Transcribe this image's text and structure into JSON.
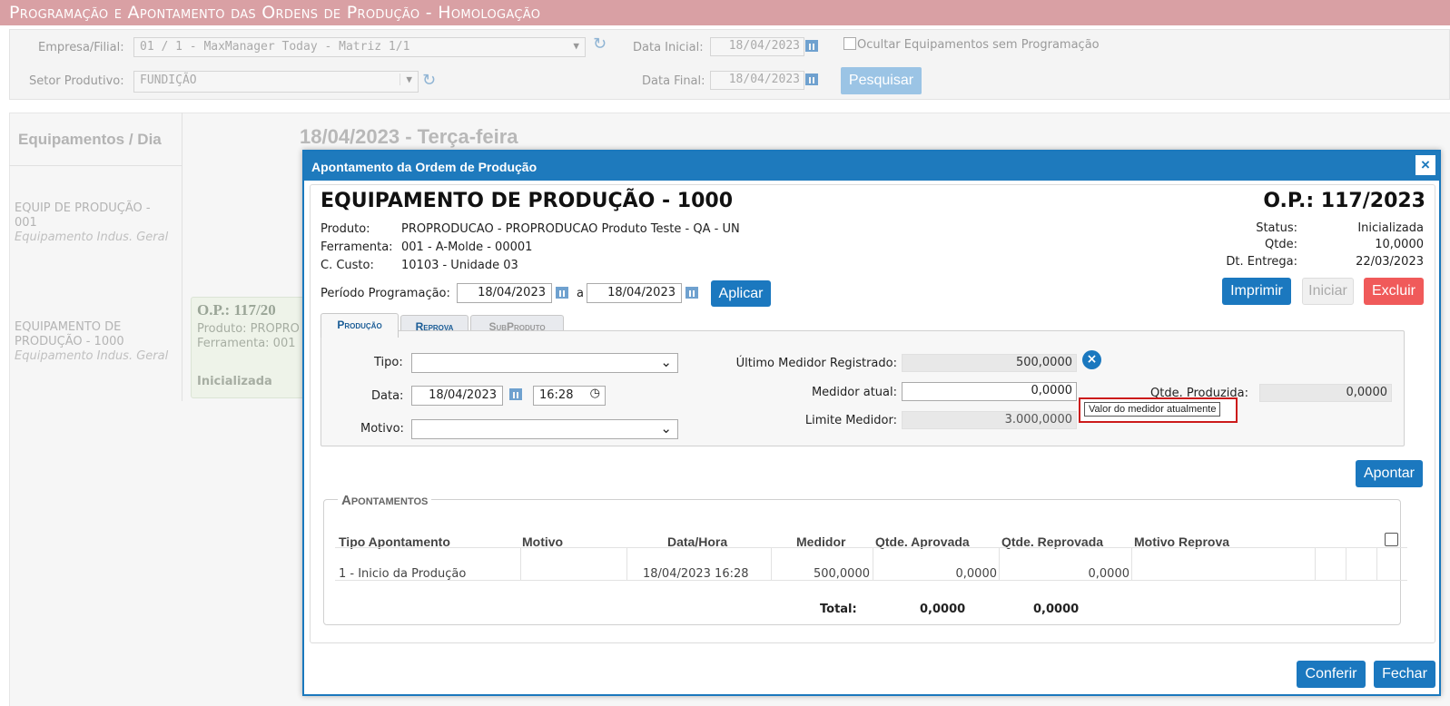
{
  "background": {
    "page_title": "Programação e Apontamento das Ordens de Produção  - Homologação",
    "empresa_label": "Empresa/Filial:",
    "empresa_value": "01 / 1 - MaxManager Today - Matriz 1/1",
    "setor_label": "Setor Produtivo:",
    "setor_value": "FUNDIÇÃO",
    "data_inicial_label": "Data Inicial:",
    "data_inicial_value": "18/04/2023",
    "data_final_label": "Data Final:",
    "data_final_value": "18/04/2023",
    "ocultar_label": "Ocultar Equipamentos sem Programação",
    "pesquisar_label": "Pesquisar",
    "grid_header": "Equipamentos / Dia",
    "day_header": "18/04/2023 - Terça-feira",
    "equip1_name_a": "EQUIP DE PRODUÇÃO -",
    "equip1_name_b": "001",
    "equip1_sub": "Equipamento Indus. Geral",
    "equip2_name_a": "EQUIPAMENTO DE",
    "equip2_name_b": "PRODUÇÃO - 1000",
    "equip2_sub": "Equipamento Indus. Geral",
    "card_op": "O.P.: 117/20",
    "card_produto": "Produto: PROPRO",
    "card_ferramenta": "Ferramenta: 001",
    "card_status": "Inicializada"
  },
  "modal": {
    "title": "Apontamento da Ordem de Produção",
    "close_icon": "×",
    "equipamento": "EQUIPAMENTO DE PRODUÇÃO - 1000",
    "op": "O.P.: 117/2023",
    "produto_label": "Produto:",
    "produto_value": "PROPRODUCAO - PROPRODUCAO Produto Teste - QA - UN",
    "ferramenta_label": "Ferramenta:",
    "ferramenta_value": "001 - A-Molde - 00001",
    "custo_label": "C. Custo:",
    "custo_value": "10103 - Unidade 03",
    "status_label": "Status:",
    "status_value": "Inicializada",
    "qtde_label": "Qtde:",
    "qtde_value": "10,0000",
    "entrega_label": "Dt. Entrega:",
    "entrega_value": "22/03/2023",
    "periodo_label": "Período Programação:",
    "periodo_inicio": "18/04/2023",
    "periodo_a": "a",
    "periodo_fim": "18/04/2023",
    "aplicar_label": "Aplicar",
    "imprimir_label": "Imprimir",
    "iniciar_label": "Iniciar",
    "excluir_label": "Excluir",
    "tabs": [
      "Produção",
      "Reprova",
      "SubProduto"
    ],
    "tipo_label": "Tipo:",
    "data_label": "Data:",
    "data_value": "18/04/2023",
    "hora_value": "16:28",
    "motivo_label": "Motivo:",
    "ultimo_medidor_label": "Último Medidor Registrado:",
    "ultimo_medidor_value": "500,0000",
    "medidor_atual_label": "Medidor atual:",
    "medidor_atual_value": "0,0000",
    "limite_medidor_label": "Limite Medidor:",
    "limite_medidor_value": "3.000,0000",
    "qtde_produzida_label": "Qtde. Produzida:",
    "qtde_produzida_value": "0,0000",
    "tooltip_text": "Valor do medidor atualmente",
    "apontar_label": "Apontar",
    "apontamentos_title": "Apontamentos",
    "table_headers": [
      "Tipo Apontamento",
      "Motivo",
      "Data/Hora",
      "Medidor",
      "Qtde. Aprovada",
      "Qtde. Reprovada",
      "Motivo Reprova"
    ],
    "rows": [
      {
        "tipo": "1 - Inicio da Produção",
        "motivo": "",
        "datahora": "18/04/2023 16:28",
        "medidor": "500,0000",
        "aprovada": "0,0000",
        "reprovada": "0,0000",
        "motivo_reprova": ""
      }
    ],
    "total_label": "Total:",
    "total_aprovada": "0,0000",
    "total_reprovada": "0,0000",
    "conferir_label": "Conferir",
    "fechar_label": "Fechar"
  }
}
